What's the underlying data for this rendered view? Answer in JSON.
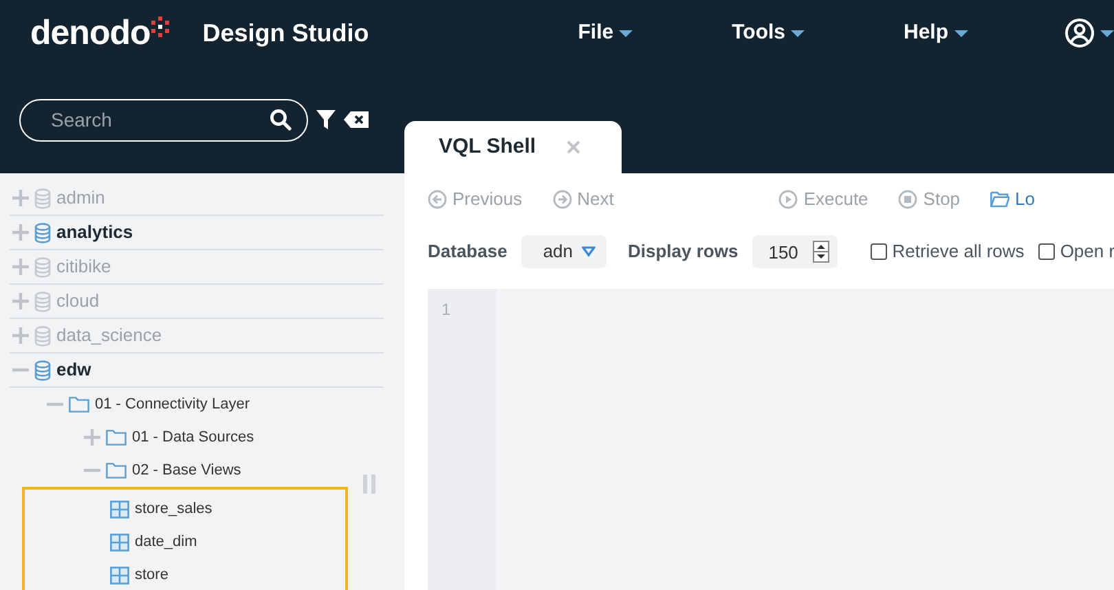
{
  "header": {
    "logo": "denodo",
    "app_title": "Design Studio",
    "menus": [
      "File",
      "Tools",
      "Help"
    ]
  },
  "sidebar": {
    "search": {
      "placeholder": "Search"
    },
    "tree": [
      {
        "label": "admin",
        "kind": "database",
        "active": false,
        "expanded": false
      },
      {
        "label": "analytics",
        "kind": "database",
        "active": true,
        "expanded": false
      },
      {
        "label": "citibike",
        "kind": "database",
        "active": false,
        "expanded": false
      },
      {
        "label": "cloud",
        "kind": "database",
        "active": false,
        "expanded": false
      },
      {
        "label": "data_science",
        "kind": "database",
        "active": false,
        "expanded": false
      },
      {
        "label": "edw",
        "kind": "database",
        "active": true,
        "expanded": true,
        "children": [
          {
            "label": "01 - Connectivity Layer",
            "kind": "folder",
            "expanded": true,
            "children": [
              {
                "label": "01 - Data Sources",
                "kind": "folder",
                "expanded": false
              },
              {
                "label": "02 - Base Views",
                "kind": "folder",
                "expanded": true,
                "children": [
                  {
                    "label": "store_sales",
                    "kind": "view",
                    "highlighted": true
                  },
                  {
                    "label": "date_dim",
                    "kind": "view",
                    "highlighted": true
                  },
                  {
                    "label": "store",
                    "kind": "view",
                    "highlighted": true
                  }
                ]
              }
            ]
          }
        ]
      }
    ]
  },
  "tabs": [
    {
      "label": "VQL Shell",
      "selected": true,
      "closable": true
    }
  ],
  "toolbar": [
    {
      "label": "Previous",
      "kind": "previous",
      "disabled": true
    },
    {
      "label": "Next",
      "kind": "next",
      "disabled": true
    },
    {
      "label": "Execute",
      "kind": "execute",
      "disabled": true
    },
    {
      "label": "Stop",
      "kind": "stop",
      "disabled": true
    },
    {
      "label": "Lo",
      "kind": "load",
      "disabled": false
    }
  ],
  "options": {
    "database_label": "Database",
    "database_value": "adn",
    "display_rows_label": "Display rows",
    "display_rows_value": "150",
    "checkboxes": [
      {
        "label": "Retrieve all rows",
        "checked": false
      },
      {
        "label": "Open r",
        "checked": false
      }
    ]
  },
  "editor": {
    "line_numbers": [
      "1"
    ]
  }
}
